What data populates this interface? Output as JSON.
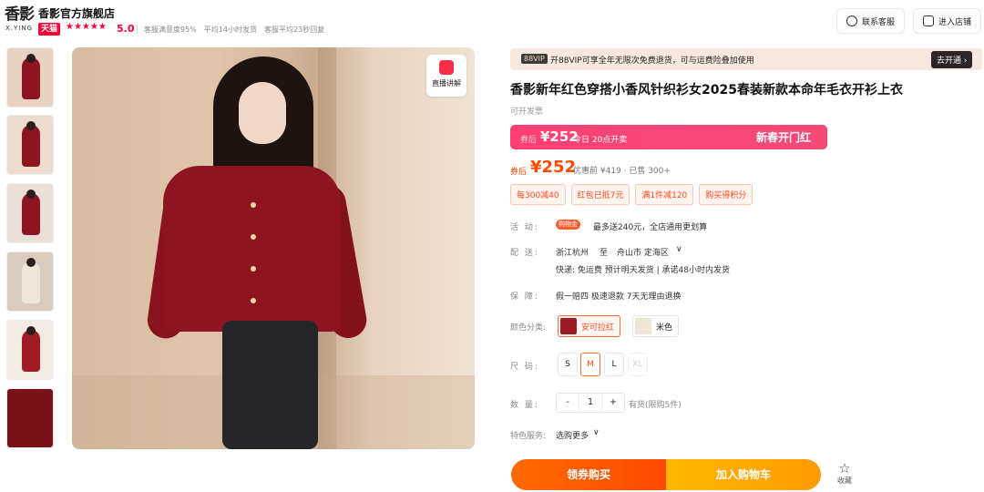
{
  "shop": {
    "logo_cn": "香影",
    "logo_en": "X.YING",
    "name": "香影官方旗舰店",
    "badge": "天猫",
    "stars": "★★★★★",
    "rating": "5.0",
    "metrics": [
      "客服满意度95%",
      "平均14小时发货",
      "客服平均23秒回复"
    ]
  },
  "header_buttons": {
    "contact": "联系客服",
    "enter_shop": "进入店铺"
  },
  "thumbnails": [
    {
      "color": "#8d1522"
    },
    {
      "color": "#8d1522"
    },
    {
      "color": "#8d1522"
    },
    {
      "color": "#efe6da"
    },
    {
      "color": "#a01b26"
    },
    {
      "color": "#7a1018"
    }
  ],
  "live_explain": "直播讲解",
  "vip": {
    "tag": "88VIP",
    "text": "开88VIP可享全年无限次免费退货，可与运费险叠加使用",
    "cta": "去开通 ›"
  },
  "product": {
    "title": "香影新年红色穿搭小香风针织衫女2025春装新款本命年毛衣开衫上衣",
    "invoice": "可开发票"
  },
  "promo": {
    "after_label": "券后",
    "price": "¥252",
    "sub": "今日 20点开卖",
    "right": "新春开门红"
  },
  "price": {
    "after_label": "券后",
    "value": "¥252",
    "before": "优惠前 ¥419 · 已售 300+"
  },
  "coupons": [
    "每300减40",
    "红包已抵7元",
    "满1件减120",
    "购买得积分"
  ],
  "activity": {
    "label": "活    动:",
    "tag": "购物金",
    "text": "最多送240元，全店通用更划算"
  },
  "delivery": {
    "label": "配    送:",
    "from": "浙江杭州",
    "to_word": "至",
    "to": "舟山市 定海区",
    "detail": "快递: 免运费   预计明天发货 | 承诺48小时内发货"
  },
  "guarantee": {
    "label": "保    障:",
    "text": "假一赔四  极速退款  7天无理由退换"
  },
  "colors": {
    "label": "颜色分类:",
    "options": [
      {
        "name": "安可拉红",
        "swatch": "#9c1a24"
      },
      {
        "name": "米色",
        "swatch": "#efe4d6"
      }
    ]
  },
  "sizes": {
    "label": "尺    码:",
    "options": [
      "S",
      "M",
      "L",
      "XL"
    ],
    "selected": "M",
    "disabled": [
      "XL"
    ]
  },
  "quantity": {
    "label": "数    量:",
    "minus": "-",
    "value": "1",
    "plus": "+",
    "stock": "有货(限购5件)"
  },
  "services": {
    "label": "特色服务:",
    "text": "选购更多",
    "chevron": "∨"
  },
  "actions": {
    "buy": "领券购买",
    "cart": "加入购物车",
    "fav": "收藏",
    "fav_icon": "☆"
  },
  "colors_theme": {
    "accent": "#ff4a00",
    "tmall_red": "#ff0036",
    "promo_pink": "#ff3f72"
  }
}
